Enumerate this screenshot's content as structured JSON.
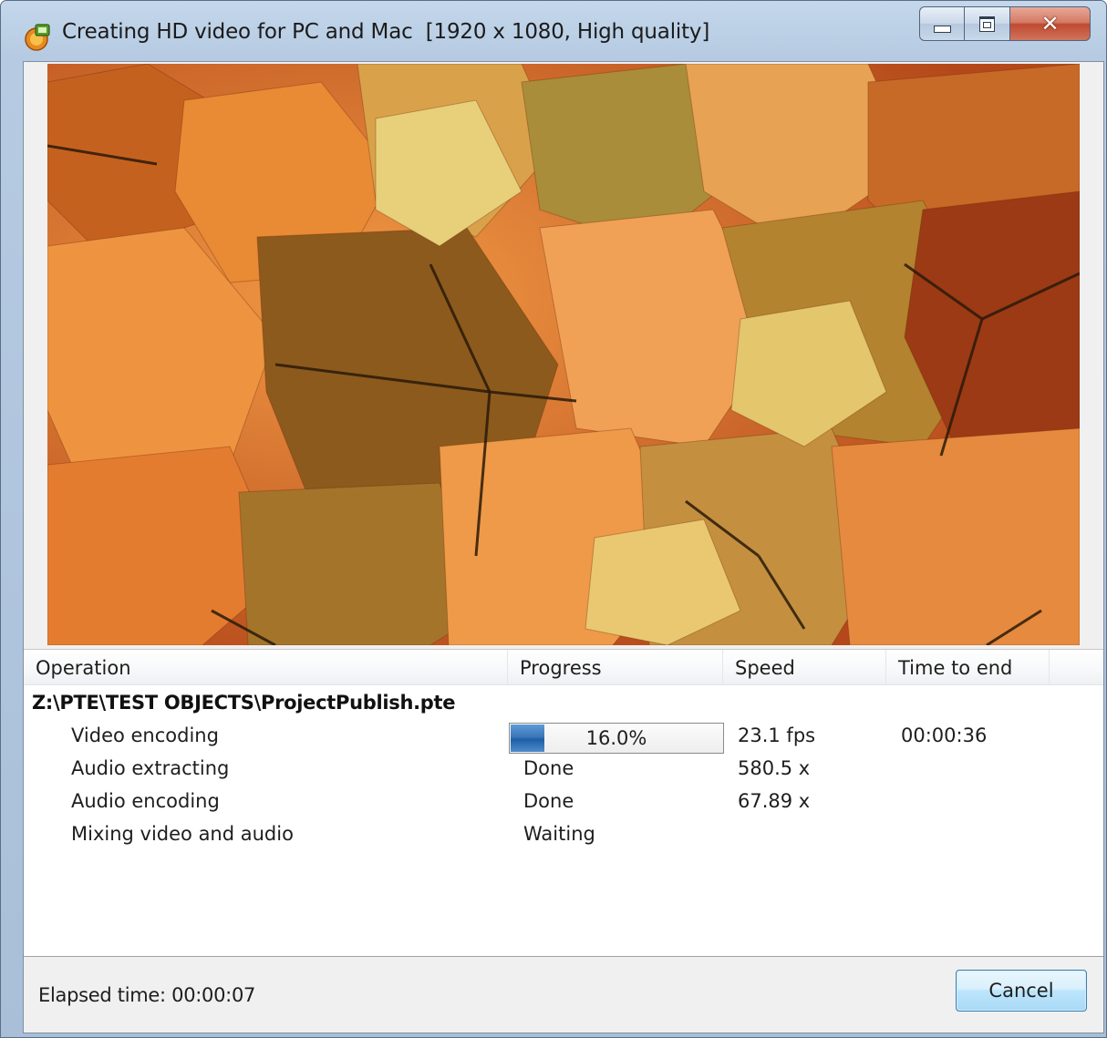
{
  "window": {
    "title": "Creating HD video for PC and Mac  [1920 x 1080, High quality]"
  },
  "caption_buttons": {
    "minimize_icon": "minimize-icon",
    "maximize_icon": "maximize-icon",
    "close_glyph": "✕"
  },
  "preview": {
    "icon": "preview-image"
  },
  "table": {
    "columns": [
      "Operation",
      "Progress",
      "Speed",
      "Time to end"
    ],
    "file": "Z:\\PTE\\TEST OBJECTS\\ProjectPublish.pte",
    "rows": [
      {
        "operation": "Video encoding",
        "progress": "16.0%",
        "progress_value": 0.16,
        "speed": "23.1 fps",
        "time_to_end": "00:00:36"
      },
      {
        "operation": "Audio extracting",
        "progress": "Done",
        "speed": "580.5 x",
        "time_to_end": ""
      },
      {
        "operation": "Audio encoding",
        "progress": "Done",
        "speed": "67.89 x",
        "time_to_end": ""
      },
      {
        "operation": "Mixing video and audio",
        "progress": "Waiting",
        "speed": "",
        "time_to_end": ""
      }
    ]
  },
  "footer": {
    "elapsed": "Elapsed time: 00:00:07",
    "cancel_label": "Cancel"
  },
  "colors": {
    "progress_fill": "#3a76ba",
    "close_button": "#c04a30"
  }
}
